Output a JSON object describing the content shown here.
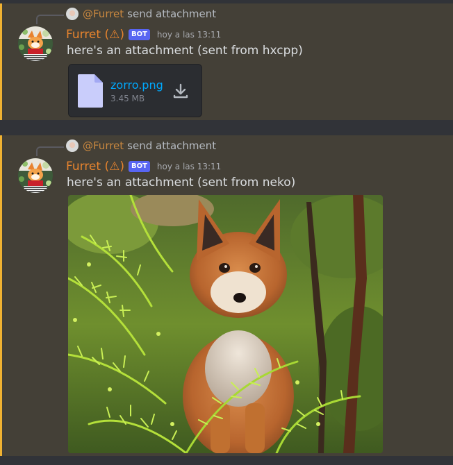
{
  "messages": [
    {
      "reply": {
        "mention": "@Furret",
        "text": "send attachment"
      },
      "author": "Furret (⚠)",
      "bot_tag": "BOT",
      "timestamp": "hoy a las 13:11",
      "content": "here's an attachment (sent from hxcpp)",
      "attachment": {
        "type": "file",
        "name": "zorro.png",
        "size": "3.45 MB",
        "icon": "file-icon",
        "action_icon": "download-icon"
      }
    },
    {
      "reply": {
        "mention": "@Furret",
        "text": "send attachment"
      },
      "author": "Furret (⚠)",
      "bot_tag": "BOT",
      "timestamp": "hoy a las 13:11",
      "content": "here's an attachment (sent from neko)",
      "attachment": {
        "type": "image",
        "subject": "fox-kit-photo"
      }
    }
  ],
  "colors": {
    "background": "#313338",
    "highlight_background": "#444037",
    "highlight_bar": "#f0b232",
    "author": "#e8842e",
    "mention": "#c8873f",
    "bot_tag": "#5865f2",
    "link": "#00a8fc"
  }
}
